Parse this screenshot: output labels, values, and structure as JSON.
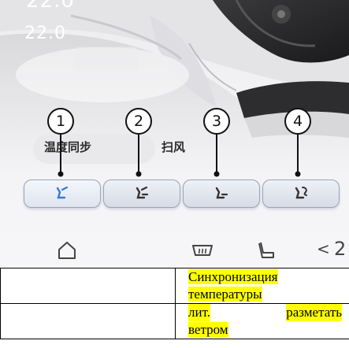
{
  "screen": {
    "temp_top": "22.0",
    "temp_main": "22.0",
    "labels": {
      "temp_sync": "温度同步",
      "sweep_wind": "扫风"
    },
    "buttons": [
      {
        "callout": "1",
        "icon": "seat-airflow-upper-icon"
      },
      {
        "callout": "2",
        "icon": "seat-airflow-upper-lower-icon"
      },
      {
        "callout": "3",
        "icon": "seat-airflow-lower-icon"
      },
      {
        "callout": "4",
        "icon": "seat-airflow-defrost-icon"
      }
    ],
    "bottom_nav": {
      "home_icon": "home-icon",
      "rear_defrost_icon": "rear-defrost-icon",
      "seat_icon": "seat-icon",
      "prev_arrow": "<",
      "partial_temp": "2"
    },
    "accent_color": "#3a78d8"
  },
  "table": {
    "rows": [
      {
        "left": "",
        "right": "Синхронизация температуры"
      },
      {
        "left": "",
        "right_line1_a": "лит.",
        "right_line1_b": "разметать",
        "right_line2": "ветром"
      }
    ]
  }
}
